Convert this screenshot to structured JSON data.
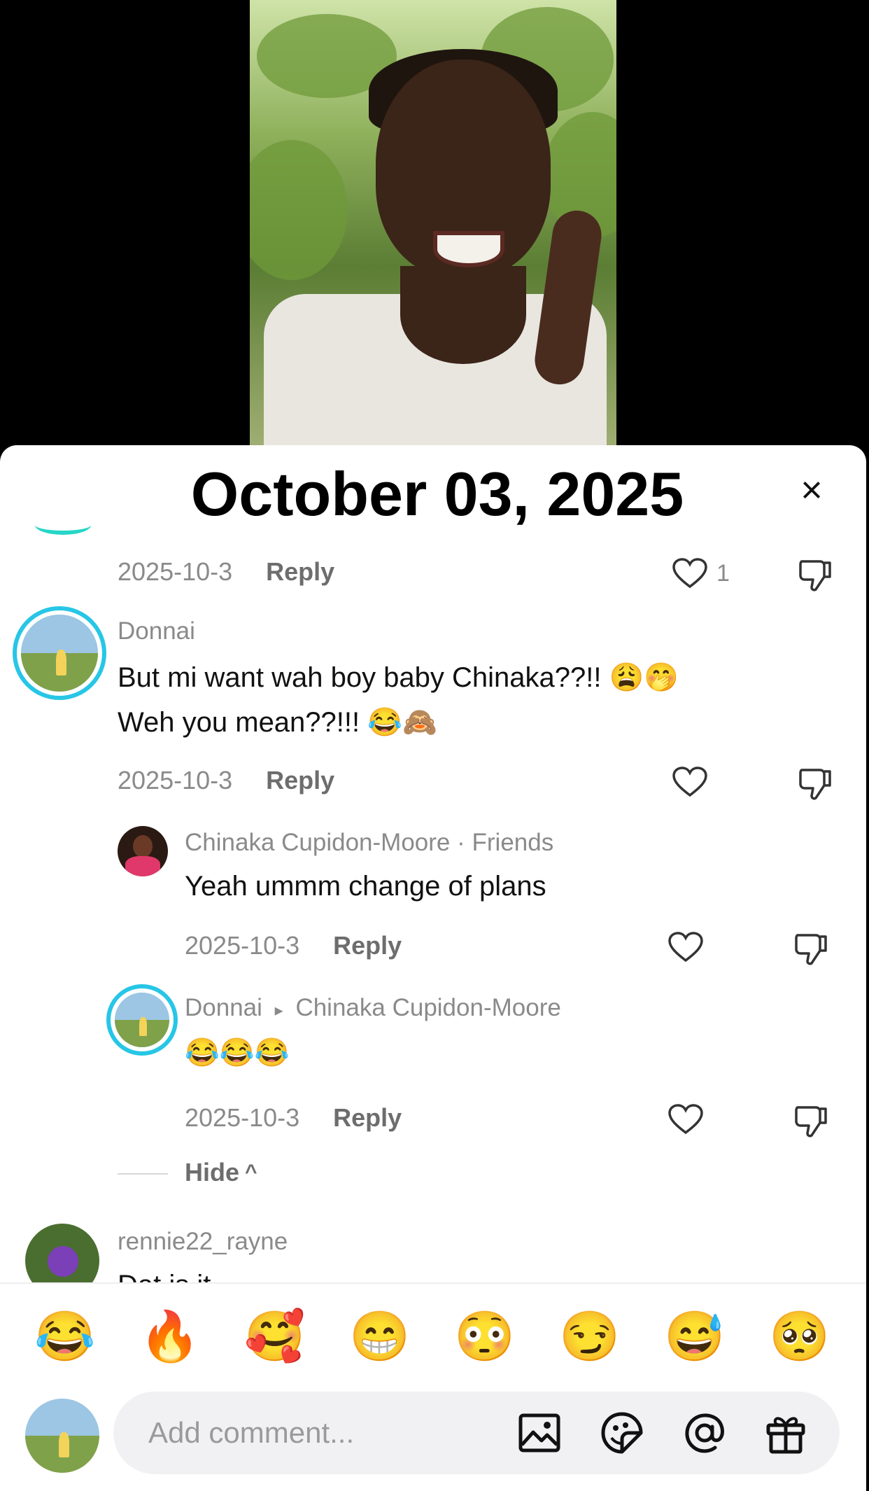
{
  "overlay": {
    "date": "October 03, 2025"
  },
  "close": {
    "glyph": "×"
  },
  "comments": [
    {
      "date": "2025-10-3",
      "reply": "Reply",
      "likes": "1"
    },
    {
      "user": "Donnai",
      "line1": "But mi want wah boy baby Chinaka??!! 😩🤭",
      "line2": "Weh you mean??!!! 😂🙈",
      "date": "2025-10-3",
      "reply": "Reply"
    },
    {
      "user": "Chinaka Cupidon-Moore",
      "tag": "· Friends",
      "text": "Yeah ummm change of plans",
      "date": "2025-10-3",
      "reply": "Reply"
    },
    {
      "user": "Donnai",
      "arrow": "▸",
      "reply_to": "Chinaka Cupidon-Moore",
      "text": "😂😂😂",
      "date": "2025-10-3",
      "reply": "Reply"
    },
    {
      "user": "rennie22_rayne",
      "text": "Dat is it"
    }
  ],
  "hide": {
    "label": "Hide",
    "icon": "^"
  },
  "emojis": [
    "😂",
    "🔥",
    "🥰",
    "😁",
    "😳",
    "😏",
    "😅",
    "🥺"
  ],
  "input": {
    "placeholder": "Add comment..."
  },
  "icons": [
    "image-icon",
    "sticker-icon",
    "mention-icon",
    "gift-icon",
    "heart-icon",
    "dislike-icon",
    "close-icon"
  ],
  "colors": {
    "accent_ring": "#27c6e6",
    "teal": "#26d6c6",
    "meta_gray": "#8a8a8a"
  }
}
